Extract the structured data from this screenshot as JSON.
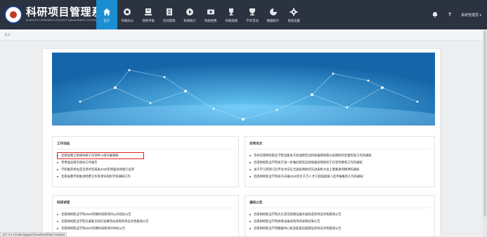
{
  "app": {
    "title": "科研项目管理系统",
    "subtitle": "SCIENTIFIC RESEARCH PROJECT MANAGEMENT SYSTEM"
  },
  "nav": [
    {
      "label": "首页",
      "icon": "home-icon",
      "active": true
    },
    {
      "label": "科研办公",
      "icon": "office-icon"
    },
    {
      "label": "项目申报",
      "icon": "declare-icon"
    },
    {
      "label": "合同管理",
      "icon": "contract-icon"
    },
    {
      "label": "科研执行",
      "icon": "execute-icon"
    },
    {
      "label": "科研经费",
      "icon": "funds-icon"
    },
    {
      "label": "科研成果",
      "icon": "trophy-icon"
    },
    {
      "label": "学术活动",
      "icon": "academic-icon"
    },
    {
      "label": "数据统计",
      "icon": "pie-chart-icon"
    },
    {
      "label": "系统设置",
      "icon": "gear-icon"
    }
  ],
  "top_right": {
    "help": "?",
    "user": "系统管理员 ▾"
  },
  "breadcrumb": "首页",
  "panels": {
    "work": {
      "title": "工作动态",
      "items": [
        "云南省教卫系统科研工作领导小组开展调研",
        "李用强总理市政协工作报告",
        "学校推荐师生首次参评云南省2020年新医改政策行议奖",
        "云南省教学校推进经费工作等领导组织学校调研工作"
      ]
    },
    "excellent": {
      "title": "优秀论文",
      "items": [
        "华共云南财经职业学院沈能关于加强新型冠状病毒感染肺炎疫情防控监督检查工作的通知",
        "云南财经职业学院关于进一步做好新型冠状病毒疫情防控工作宣传教育工作的通知",
        "关于学习贯彻习近平总书记在全国疫情防控先进表彰大会上重要讲话精神的通知",
        "云南财经职业学院关于开展2020年百千万人才工程国家级人选申报推荐工作的通知"
      ]
    },
    "research": {
      "title": "科研讲堂",
      "items": [
        "云南财经职业学院2020年教材采购项目公开招标公告",
        "云南财经职业学院交通安全知识竞赛活动采购项目竞争性磋商公告",
        "云南财经职业学院2020年教材采购项目中标公告"
      ]
    },
    "notice": {
      "title": "通知公告",
      "items": [
        "云南财经职业学院大礼堂音视频设备升级改造项目竞争性磋商公告",
        "云南财经职业学院体育设备采购项目采购结果公告",
        "云南财经职业学院数据中心机房配套设施建设项目竞争性磋商公告"
      ]
    }
  },
  "status_url": "127.0.0.1/index/pages/show/5ea1f0ae71a2a51",
  "colors": {
    "topbar": "#2b3240",
    "active_nav": "#1a8ed1",
    "highlight_border": "#e02020"
  }
}
